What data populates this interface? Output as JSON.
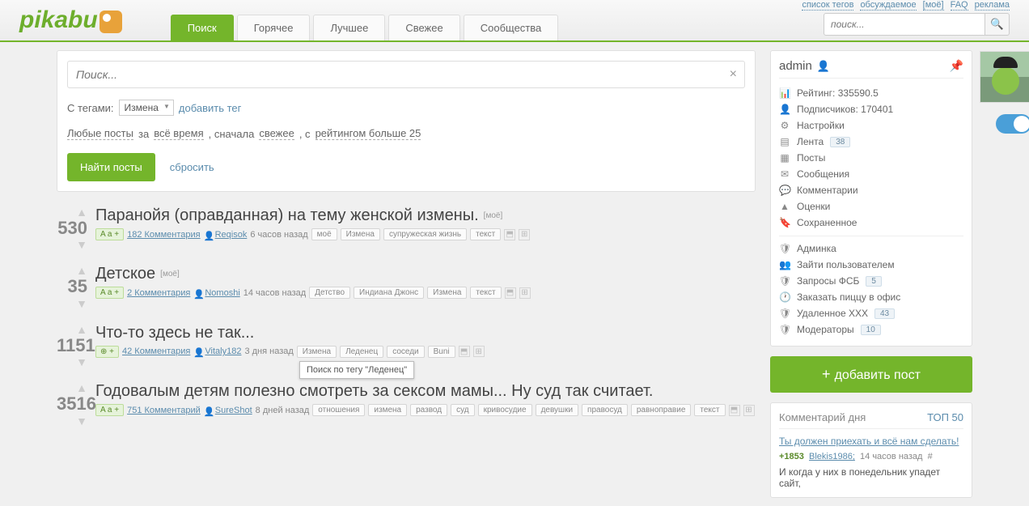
{
  "top_links": [
    "список тегов",
    "обсуждаемое",
    "[моё]",
    "FAQ",
    "реклама"
  ],
  "nav": {
    "tabs": [
      "Поиск",
      "Горячее",
      "Лучшее",
      "Свежее",
      "Сообщества"
    ],
    "active": 0
  },
  "header_search": {
    "placeholder": "поиск..."
  },
  "search_panel": {
    "input_placeholder": "Поиск...",
    "tags_label": "С тегами:",
    "selected_tag": "Измена",
    "add_tag": "добавить тег",
    "filter_parts": {
      "any": "Любые посты",
      "for": "за",
      "time": "всё время",
      "first": ", сначала",
      "fresh": "свежее",
      "with": ", с",
      "rating": "рейтингом больше 25"
    },
    "find": "Найти посты",
    "reset": "сбросить"
  },
  "tooltip": "Поиск по тегу \"Леденец\"",
  "posts": [
    {
      "rating": "530",
      "title": "Паранойя (оправданная) на тему женской измены.",
      "moe": "[моё]",
      "badge": "A a +",
      "comments": "182 Комментария",
      "author": "Reqisok",
      "time": "6 часов назад",
      "tags": [
        "моё",
        "Измена",
        "супружеская жизнь",
        "текст"
      ]
    },
    {
      "rating": "35",
      "title": "Детское",
      "moe": "[моё]",
      "badge": "A a +",
      "comments": "2 Комментария",
      "author": "Nomoshi",
      "time": "14 часов назад",
      "tags": [
        "Детство",
        "Индиана Джонс",
        "Измена",
        "текст"
      ]
    },
    {
      "rating": "1151",
      "title": "Что-то здесь не так...",
      "moe": "",
      "badge": "⊕ +",
      "comments": "42 Комментария",
      "author": "Vitaly182",
      "time": "3 дня назад",
      "tags": [
        "Измена",
        "Леденец",
        "соседи",
        "Buni"
      ]
    },
    {
      "rating": "3516",
      "title": "Годовалым детям полезно смотреть за сексом мамы... Ну суд так считает.",
      "moe": "",
      "badge": "A a +",
      "comments": "751 Комментарий",
      "author": "SureShot",
      "time": "8 дней назад",
      "tags": [
        "отношения",
        "измена",
        "развод",
        "суд",
        "кривосудие",
        "девушки",
        "правосуд",
        "равноправие",
        "текст"
      ]
    }
  ],
  "user": {
    "name": "admin",
    "rows": [
      {
        "icon": "📊",
        "label": "Рейтинг: 335590.5"
      },
      {
        "icon": "👤",
        "label": "Подписчиков: 170401"
      },
      {
        "icon": "⚙",
        "label": "Настройки"
      },
      {
        "icon": "▤",
        "label": "Лента",
        "badge": "38"
      },
      {
        "icon": "▦",
        "label": "Посты"
      },
      {
        "icon": "✉",
        "label": "Сообщения"
      },
      {
        "icon": "💬",
        "label": "Комментарии"
      },
      {
        "icon": "▲",
        "label": "Оценки"
      },
      {
        "icon": "🔖",
        "label": "Сохраненное"
      }
    ],
    "admin_rows": [
      {
        "icon": "🛡",
        "label": "Админка"
      },
      {
        "icon": "👥",
        "label": "Зайти пользователем"
      },
      {
        "icon": "🛡",
        "label": "Запросы ФСБ",
        "badge": "5"
      },
      {
        "icon": "🕐",
        "label": "Заказать пиццу в офис"
      },
      {
        "icon": "🛡",
        "label": "Удаленное XXX",
        "badge": "43"
      },
      {
        "icon": "🛡",
        "label": "Модераторы",
        "badge": "10"
      }
    ]
  },
  "add_post": "добавить пост",
  "comment_day": {
    "header": "Комментарий дня",
    "top": "ТОП 50",
    "title": "Ты должен приехать и всё нам сделать!",
    "rating": "+1853",
    "author": "Blekis1986;",
    "time": "14 часов назад",
    "hash": "#",
    "text": "И когда у них в понедельник упадет сайт,"
  }
}
